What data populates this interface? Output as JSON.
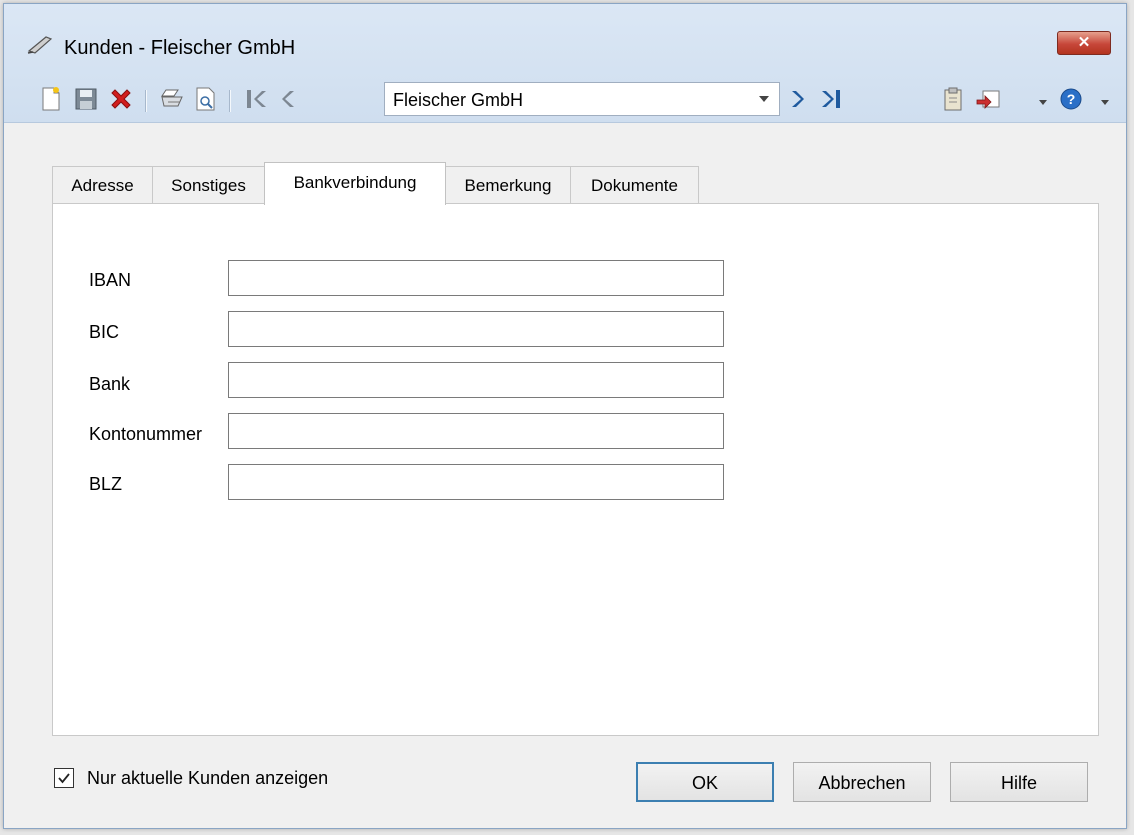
{
  "window": {
    "title": "Kunden - Fleischer GmbH",
    "close_glyph": "✕"
  },
  "toolbar": {
    "icons": [
      "new-document-icon",
      "save-icon",
      "delete-icon",
      "print-icon",
      "print-preview-icon",
      "first-record-icon",
      "previous-record-icon",
      "next-record-icon",
      "last-record-icon",
      "clipboard-icon",
      "import-icon",
      "help-icon"
    ],
    "record_selector_value": "Fleischer GmbH"
  },
  "tabs": [
    {
      "label": "Adresse",
      "active": false
    },
    {
      "label": "Sonstiges",
      "active": false
    },
    {
      "label": "Bankverbindung",
      "active": true
    },
    {
      "label": "Bemerkung",
      "active": false
    },
    {
      "label": "Dokumente",
      "active": false
    }
  ],
  "fields": [
    {
      "label": "IBAN",
      "value": ""
    },
    {
      "label": "BIC",
      "value": ""
    },
    {
      "label": "Bank",
      "value": ""
    },
    {
      "label": "Kontonummer",
      "value": ""
    },
    {
      "label": "BLZ",
      "value": ""
    }
  ],
  "footer": {
    "checkbox_label": "Nur aktuelle Kunden anzeigen",
    "checkbox_checked": true,
    "ok_label": "OK",
    "cancel_label": "Abbrechen",
    "help_label": "Hilfe"
  },
  "colors": {
    "accent": "#3c7fb1",
    "close_button": "#c7473a",
    "delete_icon": "#d21e1e",
    "nav_arrow": "#1f5a9e",
    "help_icon": "#2a6fc7"
  }
}
